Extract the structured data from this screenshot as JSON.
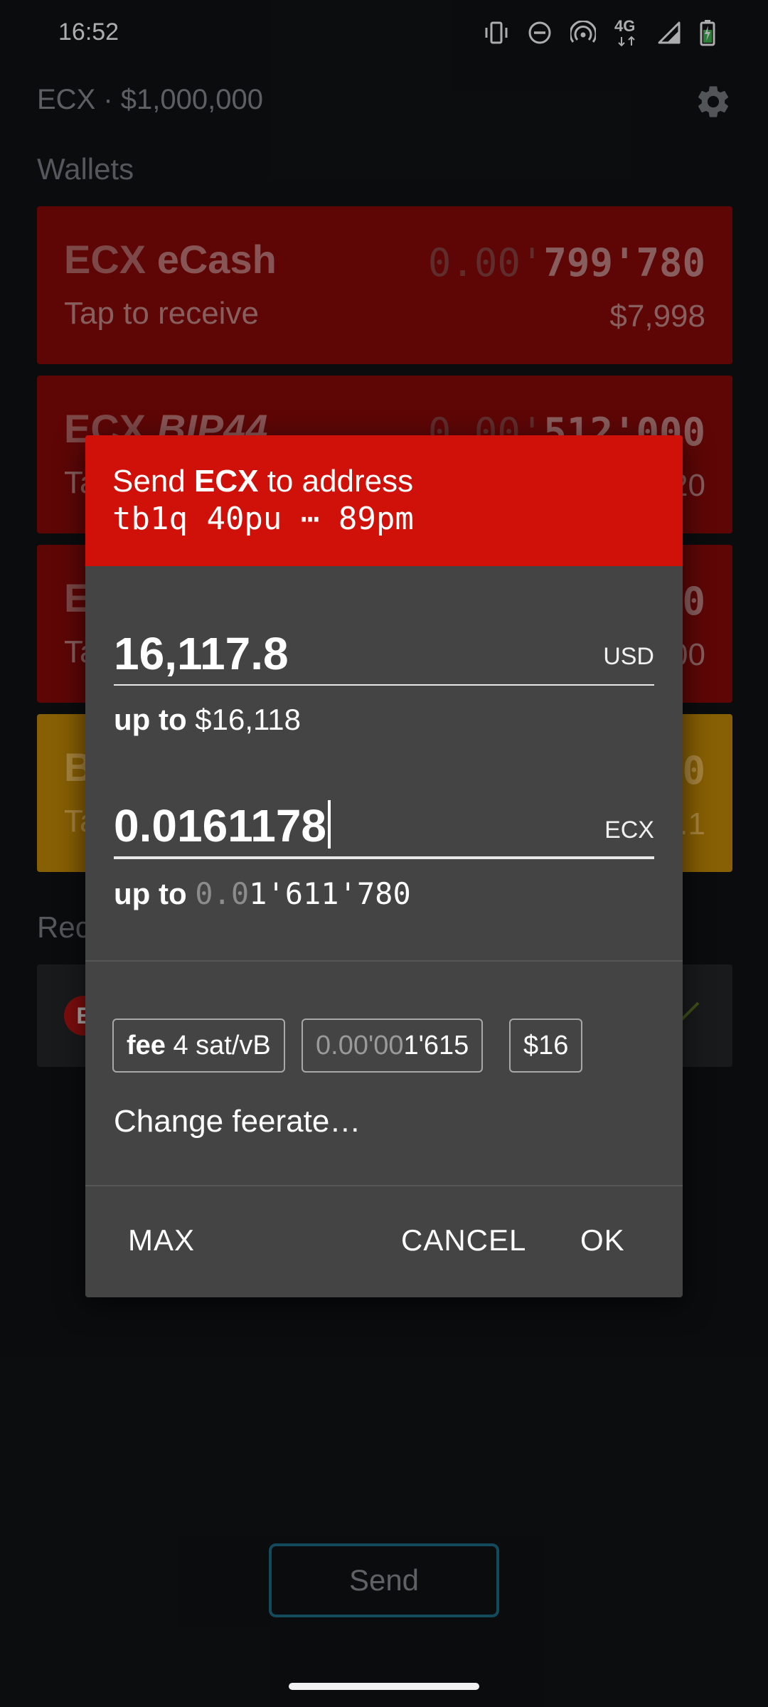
{
  "status_bar": {
    "time": "16:52",
    "network": "4G",
    "icons": [
      "vibrate-icon",
      "do-not-disturb-icon",
      "hotspot-icon",
      "network-4g-icon",
      "signal-icon",
      "battery-icon"
    ]
  },
  "app": {
    "title": "ECX · $1,000,000",
    "section_wallets": "Wallets",
    "wallets": [
      {
        "ticker": "ECX",
        "name": "eCash",
        "balance_dim": "0.00'",
        "balance": "799'780",
        "subtitle": "Tap to receive",
        "fiat": "$7,998"
      },
      {
        "ticker": "ECX",
        "name": "BIP44",
        "balance_dim": "0.00'",
        "balance": "512'000",
        "subtitle": "Ta",
        "fiat": "20"
      },
      {
        "ticker": "E",
        "name": "",
        "balance_dim": "",
        "balance": "0",
        "subtitle": "Ta",
        "fiat": "00"
      },
      {
        "ticker": "B",
        "name": "",
        "balance_dim": "",
        "balance": "0",
        "subtitle": "Ta",
        "fiat": ".1"
      }
    ],
    "section_recent": "Rec",
    "recent_badge": "E",
    "send_button": "Send"
  },
  "dialog": {
    "header_prefix": "Send ",
    "header_ticker": "ECX",
    "header_suffix": " to address",
    "address": "tb1q 40pu ⋯ 89pm",
    "usd_value": "16,117.8",
    "usd_unit": "USD",
    "usd_upto_label": "up to",
    "usd_upto_value": "$16,118",
    "ecx_value": "0.0161178",
    "ecx_unit": "ECX",
    "ecx_upto_label": "up to",
    "ecx_upto_dim": "0.0",
    "ecx_upto_value": "1'611'780",
    "fee_label": "fee",
    "fee_rate": "4 sat/vB",
    "fee_amount_dim": "0.00'00",
    "fee_amount": "1'615",
    "fee_fiat": "$16",
    "change_feerate": "Change feerate…",
    "max_button": "MAX",
    "cancel_button": "CANCEL",
    "ok_button": "OK"
  }
}
